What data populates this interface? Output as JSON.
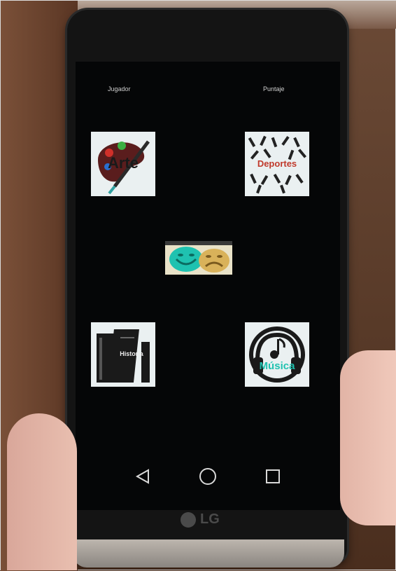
{
  "header": {
    "player_label": "Jugador",
    "score_label": "Puntaje"
  },
  "categories": {
    "arte": {
      "label": "Arte"
    },
    "deportes": {
      "label": "Deportes"
    },
    "historia": {
      "label": "Historia"
    },
    "musica": {
      "label": "Música"
    }
  },
  "center_tile": {
    "icon": "theater-masks-icon"
  },
  "nav": {
    "back_icon": "back-triangle-icon",
    "home_icon": "home-circle-icon",
    "recents_icon": "recents-square-icon"
  },
  "device_brand": "LG",
  "colors": {
    "screen_bg": "#050607",
    "tile_bg": "#eaf0f1",
    "teal_accent": "#1fc2b0",
    "red_accent": "#c0392b"
  }
}
